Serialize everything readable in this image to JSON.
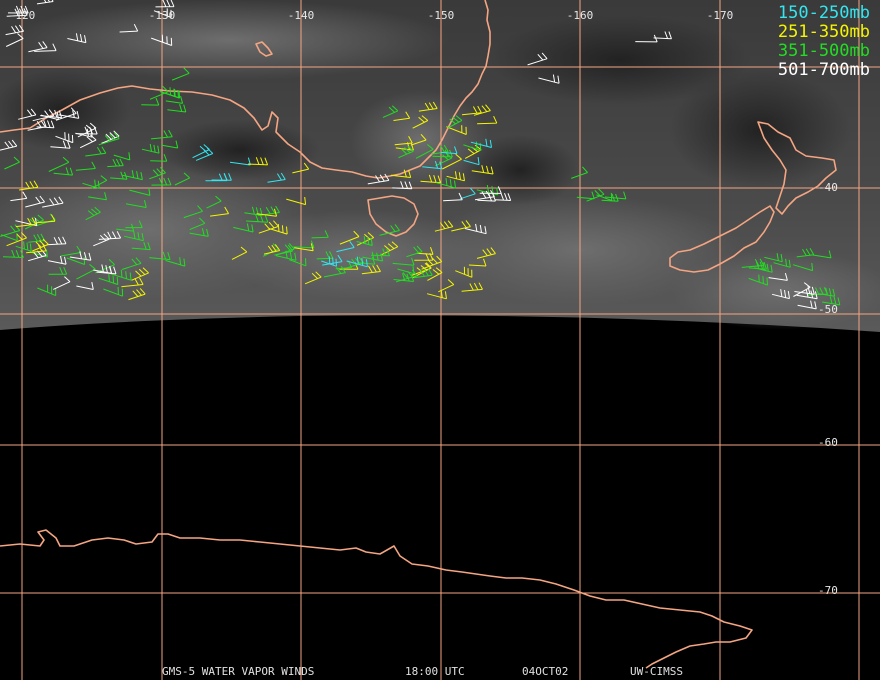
{
  "map": {
    "graticule_color": "#f4a582",
    "coast_color": "#f4a582",
    "longitudes": [
      "-120",
      "-130",
      "-140",
      "-150",
      "-160",
      "-170"
    ],
    "latitudes": [
      "-40",
      "-50",
      "-60",
      "-70"
    ]
  },
  "legend": [
    {
      "label": "150-250mb",
      "color": "#33e6f0"
    },
    {
      "label": "251-350mb",
      "color": "#f5f500"
    },
    {
      "label": "351-500mb",
      "color": "#22dd22"
    },
    {
      "label": "501-700mb",
      "color": "#ffffff"
    }
  ],
  "footer": {
    "product": "GMS-5 WATER VAPOR WINDS",
    "time": "18:00 UTC",
    "date": "04OCT02",
    "source": "UW-CIMSS"
  }
}
